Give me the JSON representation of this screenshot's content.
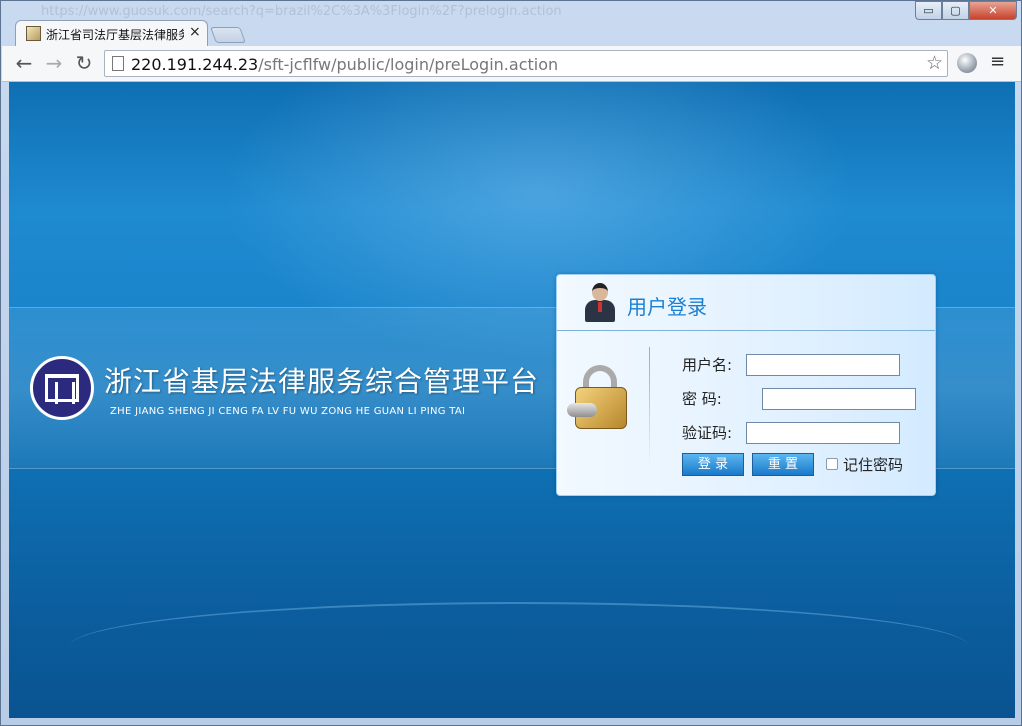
{
  "browser": {
    "background_url_text": "https://www.guosuk.com/search?q=brazil%2C%3A%3Flogin%2F?prelogin.action",
    "tab": {
      "title": "浙江省司法厅基层法律服务",
      "close": "×"
    },
    "window_buttons": {
      "minimize": "▭",
      "maximize": "▢",
      "close": "✕"
    },
    "nav": {
      "back": "←",
      "forward": "→",
      "reload": "↻"
    },
    "address": {
      "host": "220.191.244.23",
      "path": "/sft-jcflfw/public/login/preLogin.action"
    },
    "star": "☆",
    "menu": "≡"
  },
  "site": {
    "title": "浙江省基层法律服务综合管理平台",
    "pinyin": "ZHE JIANG SHENG JI CENG FA LV FU WU ZONG HE GUAN LI PING TAI"
  },
  "login": {
    "title": "用户登录",
    "username_label": "用户名:",
    "password_label": "密    码:",
    "captcha_label": "验证码:",
    "username_value": "",
    "password_value": "",
    "captcha_value": "",
    "login_button": "登 录",
    "reset_button": "重 置",
    "remember_label": "记住密码",
    "remember_checked": false
  },
  "colors": {
    "accent": "#1b7fd0",
    "background_blue": "#1a84cb"
  }
}
